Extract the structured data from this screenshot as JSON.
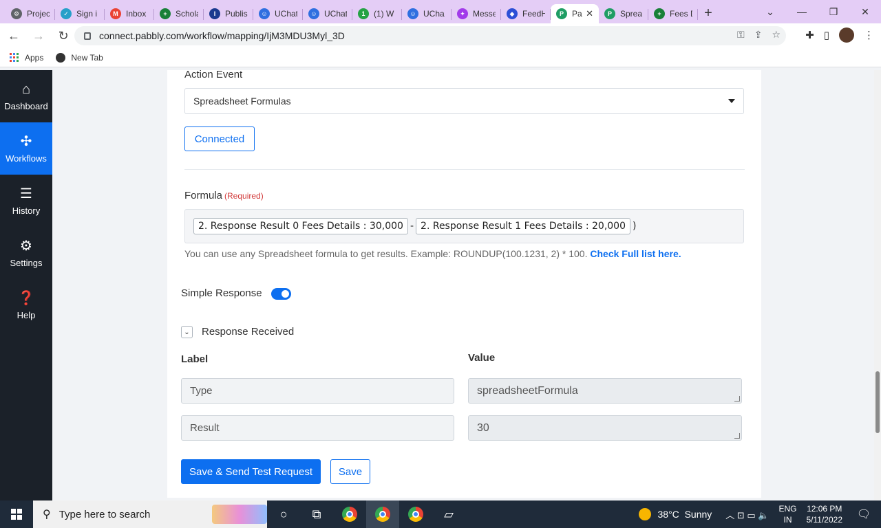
{
  "browser": {
    "tabs": [
      {
        "label": "Projec",
        "color": "#5f6368",
        "glyph": "⚙"
      },
      {
        "label": "Sign i",
        "color": "#26a0c9",
        "glyph": "✓"
      },
      {
        "label": "Inbox",
        "color": "#ea4335",
        "glyph": "M"
      },
      {
        "label": "Schola",
        "color": "#188038",
        "glyph": "+"
      },
      {
        "label": "Publis",
        "color": "#1a3a8f",
        "glyph": "I"
      },
      {
        "label": "UChat",
        "color": "#2f6fe0",
        "glyph": "☺"
      },
      {
        "label": "UChat",
        "color": "#2f6fe0",
        "glyph": "☺"
      },
      {
        "label": "(1) W",
        "color": "#25a244",
        "glyph": "1"
      },
      {
        "label": "UCha",
        "color": "#2f6fe0",
        "glyph": "☺"
      },
      {
        "label": "Messe",
        "color": "#a23bea",
        "glyph": "✦"
      },
      {
        "label": "FeedH",
        "color": "#2c4fd6",
        "glyph": "◆"
      },
      {
        "label": "Pa",
        "color": "#1f9d64",
        "glyph": "P",
        "active": true
      },
      {
        "label": "Sprea",
        "color": "#1f9d64",
        "glyph": "P"
      },
      {
        "label": "Fees D",
        "color": "#188038",
        "glyph": "+"
      }
    ],
    "url": "connect.pabbly.com/workflow/mapping/IjM3MDU3Myl_3D",
    "bookmarks": {
      "apps": "Apps",
      "new_tab": "New Tab"
    }
  },
  "sidebar": {
    "items": [
      {
        "label": "Dashboard",
        "icon": "home-icon"
      },
      {
        "label": "Workflows",
        "icon": "workflow-icon"
      },
      {
        "label": "History",
        "icon": "list-icon"
      },
      {
        "label": "Settings",
        "icon": "gear-icon"
      },
      {
        "label": "Help",
        "icon": "help-icon"
      }
    ]
  },
  "form": {
    "action_event_label": "Action Event",
    "action_event_value": "Spreadsheet Formulas",
    "connected_label": "Connected",
    "formula_label": "Formula",
    "required_label": "(Required)",
    "formula_chip_1": "2. Response Result 0 Fees Details : 30,000",
    "formula_operator": "-",
    "formula_chip_2": "2. Response Result 1 Fees Details : 20,000",
    "formula_close": ")",
    "helper_text": "You can use any Spreadsheet formula to get results. Example: ROUNDUP(100.1231, 2) * 100.",
    "helper_link": "Check Full list here.",
    "simple_response_label": "Simple Response",
    "response_received_label": "Response Received",
    "label_header": "Label",
    "value_header": "Value",
    "rows": [
      {
        "label": "Type",
        "value": "spreadsheetFormula"
      },
      {
        "label": "Result",
        "value": "30"
      }
    ],
    "save_send_label": "Save & Send Test Request",
    "save_label": "Save"
  },
  "taskbar": {
    "search_placeholder": "Type here to search",
    "temperature": "38°C",
    "weather": "Sunny",
    "lang_1": "ENG",
    "lang_2": "IN",
    "time": "12:06 PM",
    "date": "5/11/2022"
  }
}
